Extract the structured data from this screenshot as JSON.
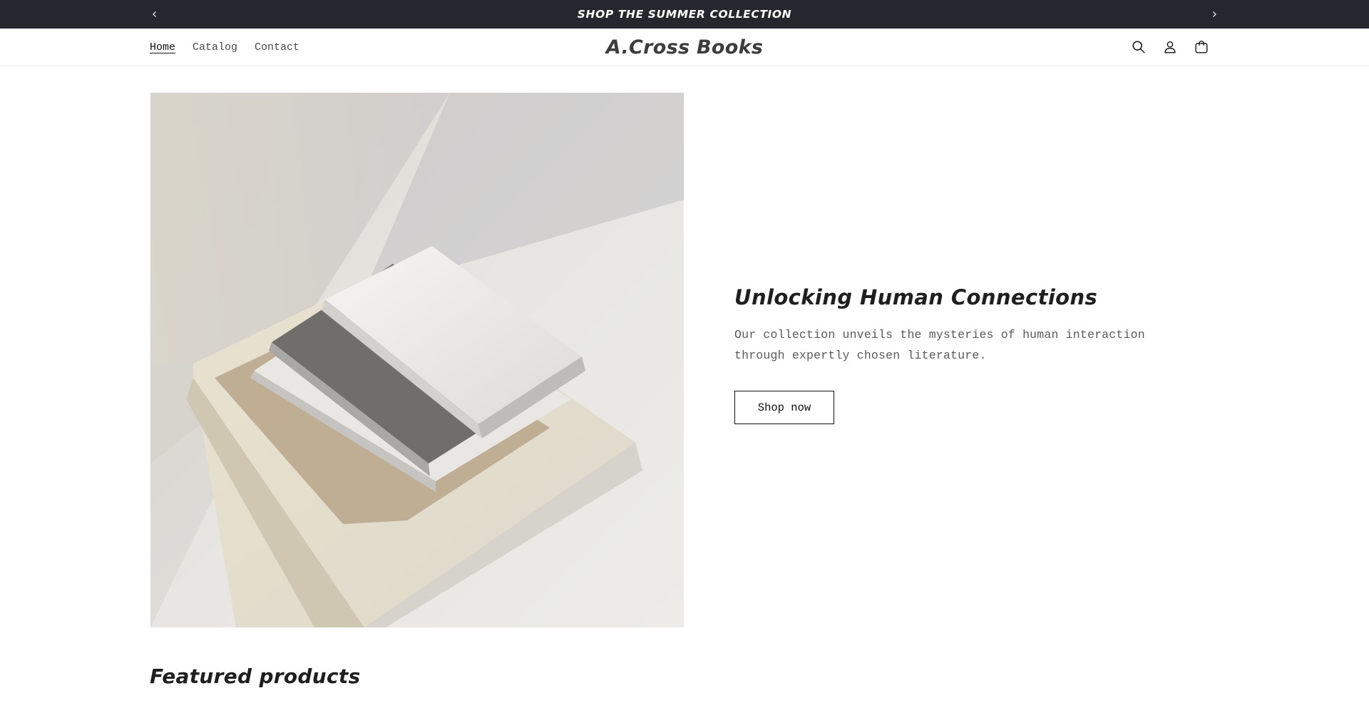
{
  "announcement": {
    "message": "SHOP THE SUMMER COLLECTION",
    "prev_icon": "chevron-left-icon",
    "next_icon": "chevron-right-icon"
  },
  "header": {
    "nav": [
      {
        "label": "Home",
        "active": true
      },
      {
        "label": "Catalog",
        "active": false
      },
      {
        "label": "Contact",
        "active": false
      }
    ],
    "brand": "A.Cross Books",
    "icons": [
      "search-icon",
      "account-icon",
      "cart-icon"
    ]
  },
  "hero": {
    "title": "Unlocking Human Connections",
    "description": "Our collection unveils the mysteries of human interaction through expertly chosen literature.",
    "button_label": "Shop now"
  },
  "featured": {
    "title": "Featured products"
  },
  "colors": {
    "announcement_bg": "#26262e",
    "text": "#121212",
    "border": "#e6e6e6"
  }
}
